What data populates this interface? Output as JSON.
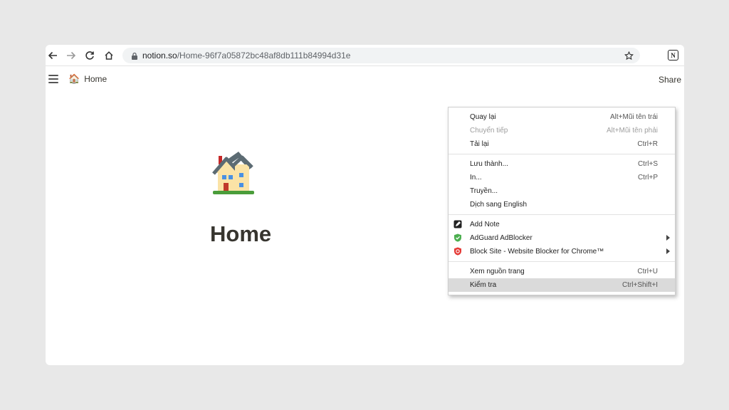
{
  "browser": {
    "url_domain": "notion.so",
    "url_path": "/Home-96f7a05872bc48af8db111b84994d31e",
    "extension_letter": "N"
  },
  "notion": {
    "breadcrumb_icon": "🏠",
    "breadcrumb_label": "Home",
    "share_label": "Share",
    "page_title": "Home"
  },
  "context_menu": {
    "group1": [
      {
        "label": "Quay lại",
        "shortcut": "Alt+Mũi tên trái"
      },
      {
        "label": "Chuyển tiếp",
        "shortcut": "Alt+Mũi tên phải"
      },
      {
        "label": "Tải lại",
        "shortcut": "Ctrl+R"
      }
    ],
    "group2": [
      {
        "label": "Lưu thành...",
        "shortcut": "Ctrl+S"
      },
      {
        "label": "In...",
        "shortcut": "Ctrl+P"
      },
      {
        "label": "Truyền..."
      },
      {
        "label": "Dịch sang English"
      }
    ],
    "group3": [
      {
        "label": "Add Note"
      },
      {
        "label": "AdGuard AdBlocker"
      },
      {
        "label": "Block Site - Website Blocker for Chrome™"
      }
    ],
    "group4": [
      {
        "label": "Xem nguồn trang",
        "shortcut": "Ctrl+U"
      },
      {
        "label": "Kiểm tra",
        "shortcut": "Ctrl+Shift+I"
      }
    ]
  },
  "colors": {
    "accent_green": "#4caf50",
    "block_red": "#e53935"
  }
}
